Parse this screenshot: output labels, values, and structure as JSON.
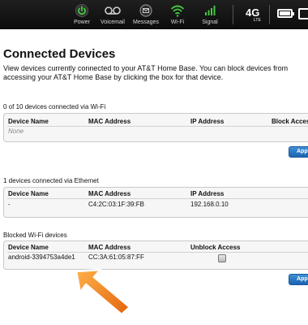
{
  "statusbar": {
    "items": [
      {
        "label": "Power",
        "icon": "power-icon"
      },
      {
        "label": "Voicemail",
        "icon": "voicemail-icon"
      },
      {
        "label": "Messages",
        "icon": "messages-icon"
      },
      {
        "label": "Wi-Fi",
        "icon": "wifi-icon"
      },
      {
        "label": "Signal",
        "icon": "signal-icon"
      }
    ],
    "network": "4G",
    "network_sub": "LTE",
    "accent": "#3bbf3b"
  },
  "page": {
    "title": "Connected Devices",
    "intro": "View devices currently connected to your AT&T Home Base. You can block devices from accessing your AT&T Home Base by clicking the box for that device."
  },
  "wifi": {
    "summary": "0 of 10  devices connected via Wi-Fi",
    "columns": [
      "Device Name",
      "MAC Address",
      "IP Address",
      "Block Access"
    ],
    "rows": [
      {
        "name": "None"
      }
    ],
    "apply_label": "Apply"
  },
  "ethernet": {
    "summary": "1 devices connected via Ethernet",
    "columns": [
      "Device Name",
      "MAC Address",
      "IP Address"
    ],
    "rows": [
      {
        "name": "-",
        "mac": "C4:2C:03:1F:39:FB",
        "ip": "192.168.0.10"
      }
    ]
  },
  "blocked": {
    "summary": "Blocked Wi-Fi devices",
    "columns": [
      "Device Name",
      "MAC Address",
      "Unblock Access"
    ],
    "rows": [
      {
        "name": "android-3394753a4de1",
        "mac": "CC:3A:61:05:87:FF"
      }
    ],
    "apply_label": "Apply"
  },
  "colors": {
    "button": "#1a63b0",
    "arrow": "#f07d1a"
  }
}
